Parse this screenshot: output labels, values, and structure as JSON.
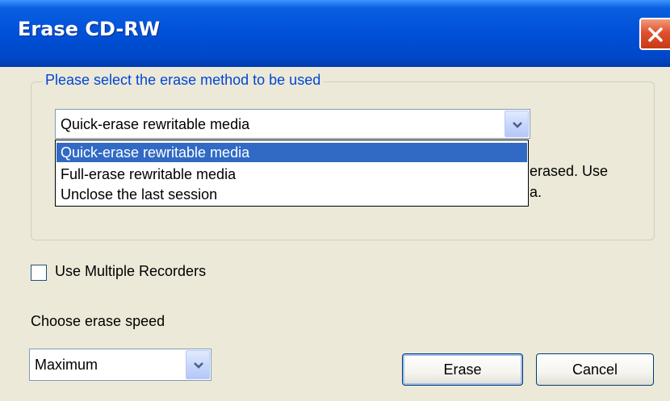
{
  "window": {
    "title": "Erase CD-RW"
  },
  "group": {
    "legend": "Please select the erase method to be used"
  },
  "method_combo": {
    "selected": "Quick-erase rewritable media",
    "options": [
      "Quick-erase rewritable media",
      "Full-erase rewritable media",
      "Unclose the last session"
    ],
    "highlighted_index": 0
  },
  "description": {
    "line1_visible": "erased. Use",
    "line2_visible": "a."
  },
  "multiple_recorders": {
    "label": "Use Multiple Recorders",
    "checked": false
  },
  "speed": {
    "label": "Choose erase speed",
    "selected": "Maximum"
  },
  "buttons": {
    "erase": "Erase",
    "cancel": "Cancel"
  },
  "icons": {
    "close": "close-icon",
    "dropdown": "chevron-down-icon"
  },
  "colors": {
    "titlebar": "#0050d8",
    "legend_text": "#0046d5",
    "selection": "#316ac5",
    "dialog_bg": "#ece9d8",
    "close_button": "#e0502c"
  }
}
